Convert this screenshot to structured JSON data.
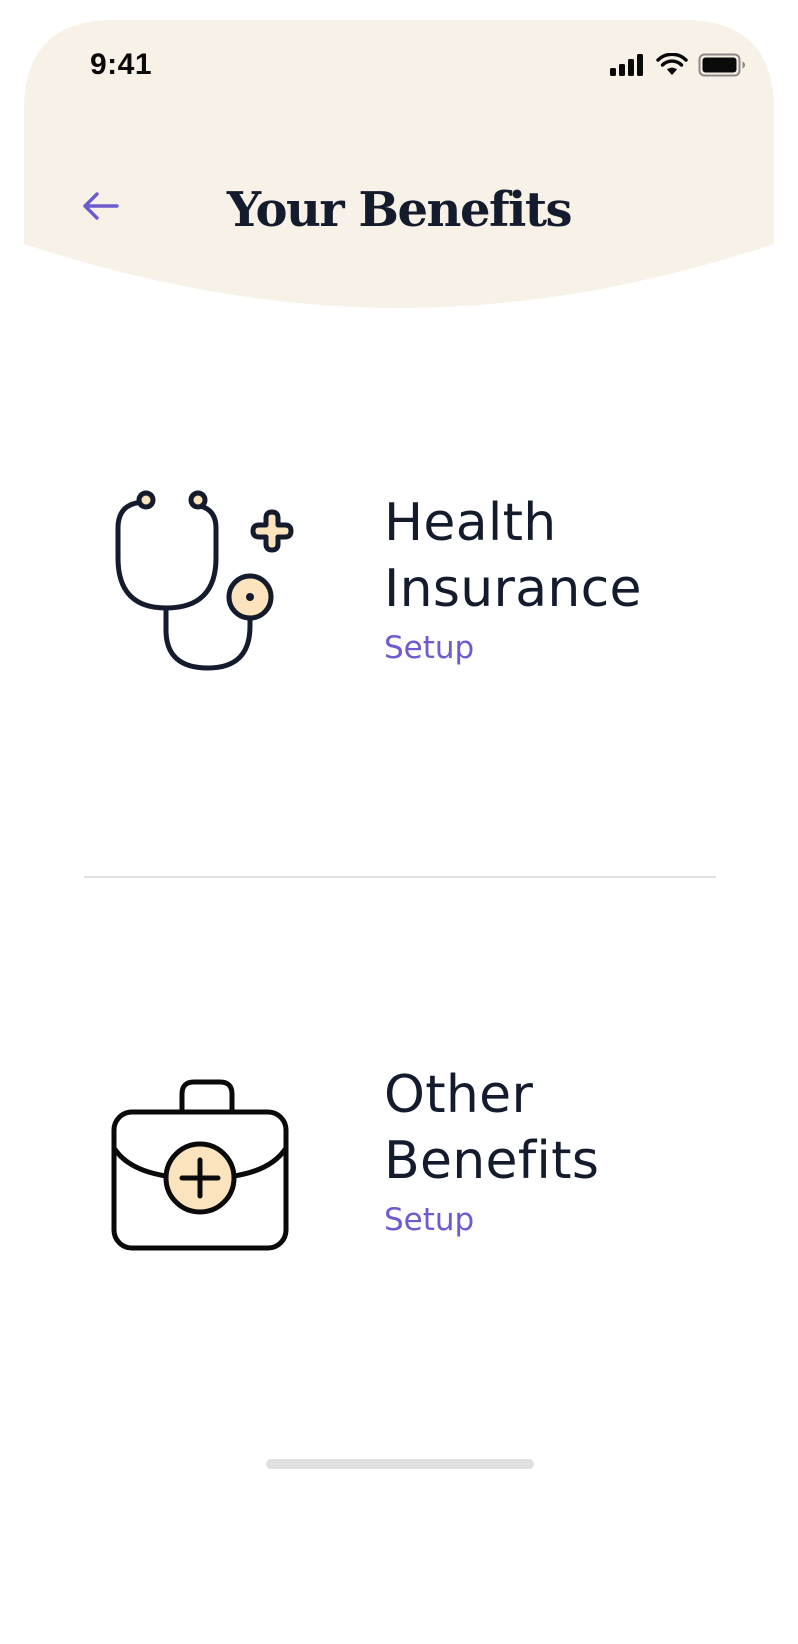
{
  "colors": {
    "header_bg": "#f7f1e7",
    "accent": "#6d5bd0",
    "text": "#141b2d",
    "icon_fill": "#fbe3bd",
    "divider": "#e2e2e2"
  },
  "status_bar": {
    "time": "9:41",
    "icons": [
      "cellular-signal-icon",
      "wifi-icon",
      "battery-icon"
    ]
  },
  "header": {
    "back_icon": "arrow-left-icon",
    "title": "Your Benefits"
  },
  "benefits": [
    {
      "icon": "stethoscope-icon",
      "title_line1": "Health",
      "title_line2": "Insurance",
      "action": "Setup"
    },
    {
      "icon": "medical-briefcase-icon",
      "title_line1": "Other",
      "title_line2": "Benefits",
      "action": "Setup"
    }
  ]
}
